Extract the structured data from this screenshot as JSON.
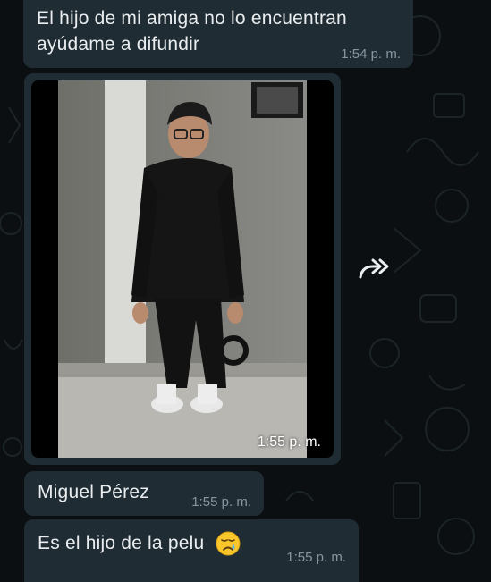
{
  "chat": {
    "messages": [
      {
        "text": "El hijo de mi amiga no lo encuentran ayúdame a difundir",
        "time": "1:54 p. m."
      },
      {
        "type": "image",
        "time": "1:55 p. m."
      },
      {
        "text": "Miguel Pérez",
        "time": "1:55 p. m."
      },
      {
        "text": "Es el hijo de la pelu",
        "emoji": "crying-face",
        "time": "1:55 p. m."
      }
    ],
    "forward_icon": "forward-icon"
  },
  "colors": {
    "background": "#0b0f12",
    "bubble": "#202c33",
    "text": "#e9edef",
    "timestamp": "#8696a0"
  }
}
